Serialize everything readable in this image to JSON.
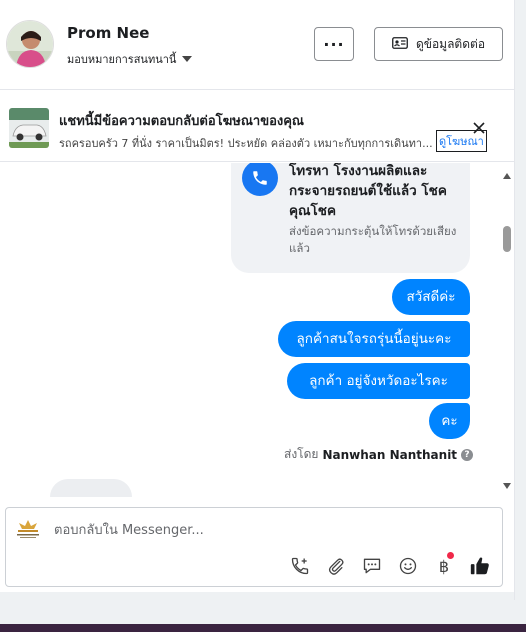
{
  "header": {
    "user_name": "Prom Nee",
    "assign_label": "มอบหมายการสนทนานี้",
    "more_label": "···",
    "contact_button": "ดูข้อมูลติดต่อ"
  },
  "ad": {
    "title": "แชทนี้มีข้อความตอบกลับต่อโฆษณาของคุณ",
    "subtitle": "รถครอบครัว 7 ที่นั่ง ราคาเป็นมิตร! ประหยัด คล่องตัว เหมาะกับทุกการเดินทา...",
    "link_label": "ดูโฆษณา"
  },
  "card": {
    "title": "โทรหา โรงงานผลิตและกระจายรถยนต์ใช้แล้ว โชคคุณโชค",
    "subtitle": "ส่งข้อความกระตุ้นให้โทรด้วยเสียงแล้ว"
  },
  "messages": [
    "สวัสดีค่ะ",
    "ลูกค้าสนใจรถรุ่นนี้อยู่นะคะ",
    "ลูกค้า  อยู่จังหวัดอะไรคะ",
    "คะ"
  ],
  "sent_by": {
    "prefix": "ส่งโดย",
    "name": "Nanwhan Nanthanit",
    "help": "?"
  },
  "composer": {
    "placeholder": "ตอบกลับใน Messenger..."
  },
  "toolbar": {
    "baht_symbol": "฿"
  },
  "colors": {
    "accent": "#1877f2",
    "bubble": "#0084ff",
    "notification_dot": "#f02849"
  }
}
